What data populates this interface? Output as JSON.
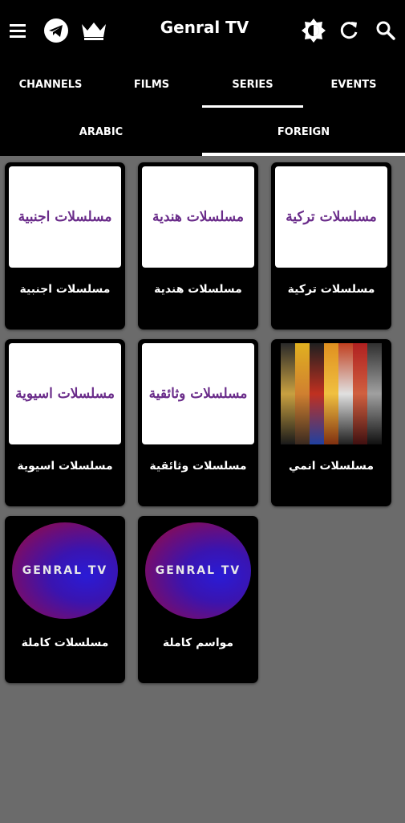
{
  "app": {
    "title": "Genral TV"
  },
  "topbar_icons": [
    "menu-icon",
    "telegram-icon",
    "crown-icon",
    "brightness-icon",
    "refresh-icon",
    "search-icon"
  ],
  "tabs": [
    {
      "label": "CHANNELS",
      "selected": false
    },
    {
      "label": "FILMS",
      "selected": false
    },
    {
      "label": "SERIES",
      "selected": true
    },
    {
      "label": "EVENTS",
      "selected": false
    }
  ],
  "subtabs": [
    {
      "label": "ARABIC",
      "selected": false
    },
    {
      "label": "FOREIGN",
      "selected": true
    }
  ],
  "cards": [
    {
      "thumb_text": "مسلسلات اجنبية",
      "label": "مسلسلات اجنبية"
    },
    {
      "thumb_text": "مسلسلات هندية",
      "label": "مسلسلات هندية"
    },
    {
      "thumb_text": "مسلسلات تركية",
      "label": "مسلسلات تركية"
    },
    {
      "thumb_text": "مسلسلات اسيوية",
      "label": "مسلسلات اسيوية"
    },
    {
      "thumb_text": "مسلسلات وثائقية",
      "label": "مسلسلات وثائقية"
    },
    {
      "thumb_text": "",
      "label": "مسلسلات انمي"
    },
    {
      "thumb_text": "GENRAL TV",
      "label": "مسلسلات كاملة"
    },
    {
      "thumb_text": "GENRAL TV",
      "label": "مواسم كاملة"
    }
  ],
  "colors": {
    "bar": "#000000",
    "background": "#6b6b6b",
    "thumb_text": "#6a2c8a"
  }
}
